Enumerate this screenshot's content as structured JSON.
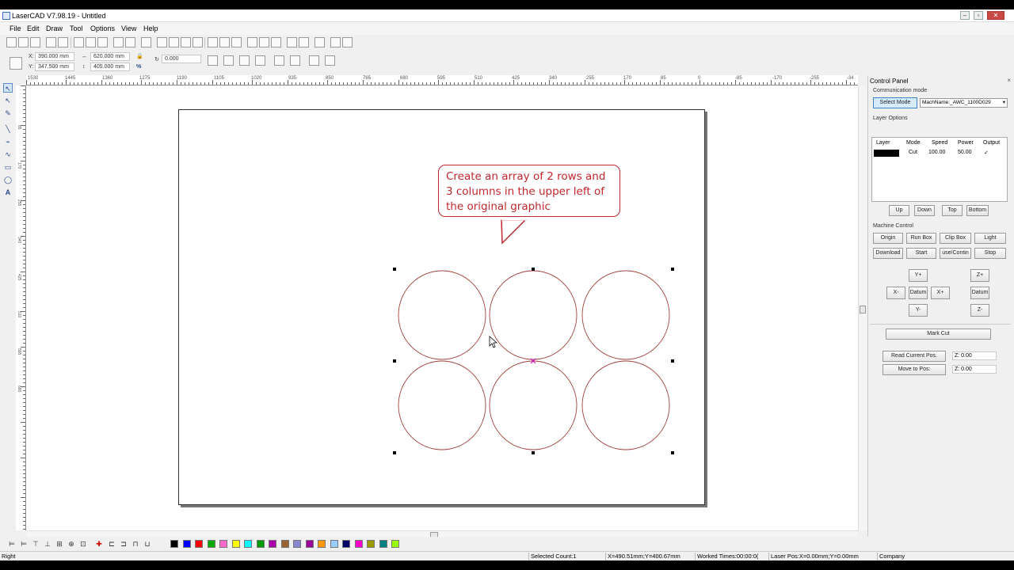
{
  "window": {
    "title": "LaserCAD V7.98.19 - Untitled"
  },
  "menu": [
    "File",
    "Edit",
    "Draw",
    "Tool",
    "Options",
    "View",
    "Help"
  ],
  "properties": {
    "x_label": "X:",
    "x_value": "390.000",
    "y_label": "Y:",
    "y_value": "347.500",
    "w_value": "620.000",
    "h_value": "405.000",
    "unit": "mm",
    "rotation": "0.000",
    "percent": "%"
  },
  "ruler": {
    "top": [
      "1530",
      "1445",
      "1360",
      "1275",
      "1190",
      "1105",
      "1020",
      "935",
      "850",
      "765",
      "680",
      "595",
      "510",
      "425",
      "340",
      "255",
      "170",
      "85",
      "0",
      "-85",
      "-170",
      "-255",
      "-34"
    ],
    "left": [
      "85",
      "170",
      "255",
      "340",
      "425",
      "510",
      "595",
      "680"
    ]
  },
  "callout": {
    "text": "Create an array of 2 rows and 3 columns in the upper left of the original graphic"
  },
  "control_panel": {
    "title": "Control Panel",
    "close": "×",
    "communication_mode_label": "Communication mode",
    "select_mode": "Select Mode",
    "machine_name": "MachName:_AWC_1100D029",
    "layer_options_label": "Layer Options",
    "layer_headers": [
      "Layer",
      "Mode",
      "Speed",
      "Power",
      "Output"
    ],
    "layer_row": {
      "mode": "Cut",
      "speed": "100.00",
      "power": "50.00",
      "output": "✓"
    },
    "layer_buttons": [
      "Up",
      "Down",
      "Top",
      "Bottom"
    ],
    "machine_control_label": "Machine Control",
    "machine_buttons_row1": [
      "Origin",
      "Run Box",
      "Clip Box",
      "Light"
    ],
    "machine_buttons_row2": [
      "Download",
      "Start",
      "use/Contin",
      "Stop"
    ],
    "jog": {
      "y_plus": "Y+",
      "x_minus": "X-",
      "datum": "Datum",
      "x_plus": "X+",
      "y_minus": "Y-",
      "z_plus": "Z+",
      "z_datum": "Datum",
      "z_minus": "Z-"
    },
    "mark_cut": "Mark Cut",
    "read_current_pos": "Read Current Pos.",
    "move_to_pos": "Move to Pos:",
    "z_read": "Z: 0.00",
    "z_move": "Z: 0.00"
  },
  "palette_colors": [
    "#000000",
    "#0000ff",
    "#ff0000",
    "#00aa00",
    "#ff66cc",
    "#ffff00",
    "#00ffff",
    "#009900",
    "#aa00aa",
    "#996633",
    "#8888cc",
    "#990099",
    "#ff9900",
    "#99ccff",
    "#000066",
    "#ff00cc",
    "#999900",
    "#008080",
    "#99ff00"
  ],
  "status": {
    "left": "Right",
    "selected": "Selected Count:1",
    "coords": "X=490.51mm;Y=400.67mm",
    "worked": "Worked Times:00:00:0(",
    "laser_pos": "Laser Pos:X=0.00mm;Y=0.00mm",
    "company": "Company"
  }
}
